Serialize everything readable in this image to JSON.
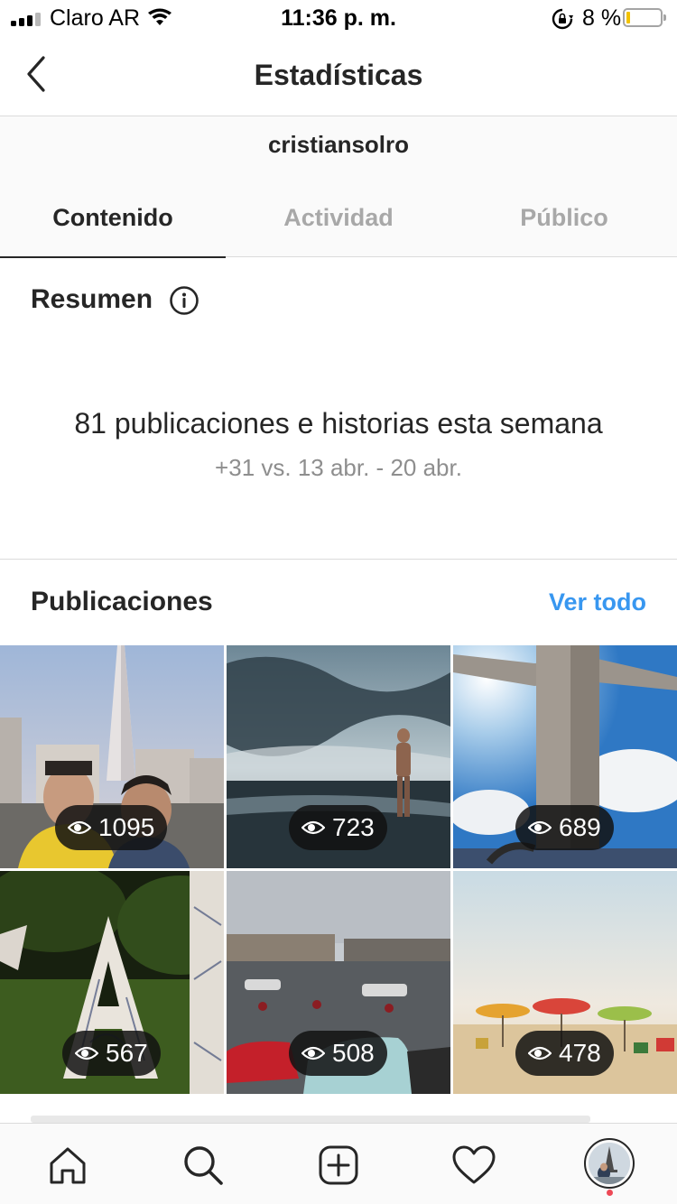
{
  "status_bar": {
    "carrier": "Claro AR",
    "time": "11:36 p. m.",
    "battery_percent": "8 %",
    "battery_level": 0.08,
    "colors": {
      "battery_fill": "#f2c200"
    }
  },
  "header": {
    "title": "Estadísticas",
    "back_icon": "chevron-left-icon"
  },
  "account": {
    "username": "cristiansolro"
  },
  "tabs": [
    {
      "label": "Contenido",
      "active": true
    },
    {
      "label": "Actividad",
      "active": false
    },
    {
      "label": "Público",
      "active": false
    }
  ],
  "summary": {
    "title": "Resumen",
    "info_icon": "info-icon",
    "headline": "81 publicaciones e historias esta semana",
    "comparison": "+31 vs. 13 abr. - 20 abr."
  },
  "posts": {
    "title": "Publicaciones",
    "see_all": "Ver todo",
    "items": [
      {
        "views": "1095",
        "icon": "eye-icon"
      },
      {
        "views": "723",
        "icon": "eye-icon"
      },
      {
        "views": "689",
        "icon": "eye-icon"
      },
      {
        "views": "567",
        "icon": "eye-icon"
      },
      {
        "views": "508",
        "icon": "eye-icon"
      },
      {
        "views": "478",
        "icon": "eye-icon"
      }
    ]
  },
  "tab_bar": {
    "items": [
      "home-icon",
      "search-icon",
      "new-post-icon",
      "activity-heart-icon",
      "profile-avatar"
    ],
    "accent_color": "#3897f0",
    "notification_color": "#ed4956"
  }
}
